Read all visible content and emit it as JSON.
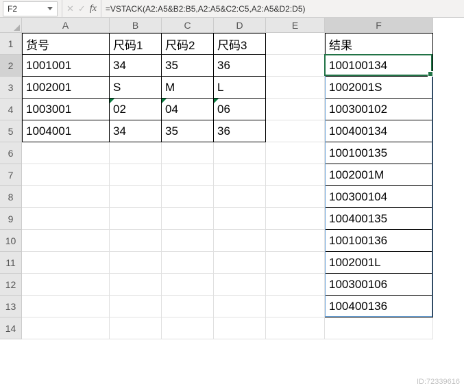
{
  "nameBox": {
    "value": "F2"
  },
  "formulaBar": {
    "cancelGlyph": "✕",
    "enterGlyph": "✓",
    "fxLabel": "fx",
    "formula": "=VSTACK(A2:A5&B2:B5,A2:A5&C2:C5,A2:A5&D2:D5)"
  },
  "columns": [
    "A",
    "B",
    "C",
    "D",
    "E",
    "F"
  ],
  "selectedColumn": "F",
  "selectedRow": 2,
  "rowCount": 14,
  "cells": {
    "A1": "货号",
    "B1": "尺码1",
    "C1": "尺码2",
    "D1": "尺码3",
    "F1": "结果",
    "A2": "1001001",
    "B2": "34",
    "C2": "35",
    "D2": "36",
    "F2": "100100134",
    "A3": "1002001",
    "B3": "S",
    "C3": "M",
    "D3": "L",
    "F3": "1002001S",
    "A4": "1003001",
    "B4": "02",
    "C4": "04",
    "D4": "06",
    "F4": "100300102",
    "A5": "1004001",
    "B5": "34",
    "C5": "35",
    "D5": "36",
    "F5": "100400134",
    "F6": "100100135",
    "F7": "1002001M",
    "F8": "100300104",
    "F9": "100400135",
    "F10": "100100136",
    "F11": "1002001L",
    "F12": "100300106",
    "F13": "100400136"
  },
  "tableA": {
    "cols": [
      "A",
      "B",
      "C",
      "D"
    ],
    "rowStart": 1,
    "rowEnd": 5
  },
  "tableF": {
    "cols": [
      "F"
    ],
    "rowStart": 1,
    "rowEnd": 13
  },
  "textCells": [
    "B4",
    "C4",
    "D4"
  ],
  "watermark": "ID:72339616"
}
